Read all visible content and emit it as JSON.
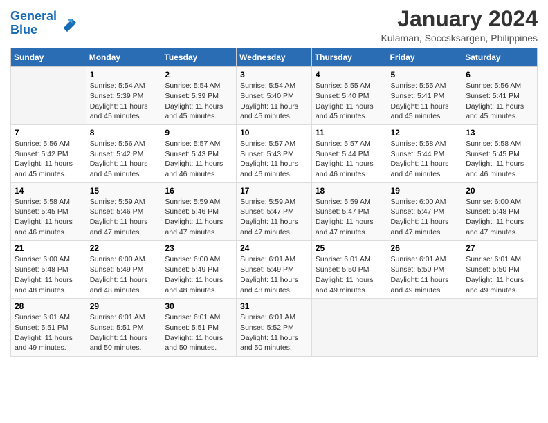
{
  "header": {
    "logo_line1": "General",
    "logo_line2": "Blue",
    "title": "January 2024",
    "subtitle": "Kulaman, Soccsksargen, Philippines"
  },
  "calendar": {
    "days_of_week": [
      "Sunday",
      "Monday",
      "Tuesday",
      "Wednesday",
      "Thursday",
      "Friday",
      "Saturday"
    ],
    "weeks": [
      [
        {
          "day": "",
          "info": ""
        },
        {
          "day": "1",
          "info": "Sunrise: 5:54 AM\nSunset: 5:39 PM\nDaylight: 11 hours\nand 45 minutes."
        },
        {
          "day": "2",
          "info": "Sunrise: 5:54 AM\nSunset: 5:39 PM\nDaylight: 11 hours\nand 45 minutes."
        },
        {
          "day": "3",
          "info": "Sunrise: 5:54 AM\nSunset: 5:40 PM\nDaylight: 11 hours\nand 45 minutes."
        },
        {
          "day": "4",
          "info": "Sunrise: 5:55 AM\nSunset: 5:40 PM\nDaylight: 11 hours\nand 45 minutes."
        },
        {
          "day": "5",
          "info": "Sunrise: 5:55 AM\nSunset: 5:41 PM\nDaylight: 11 hours\nand 45 minutes."
        },
        {
          "day": "6",
          "info": "Sunrise: 5:56 AM\nSunset: 5:41 PM\nDaylight: 11 hours\nand 45 minutes."
        }
      ],
      [
        {
          "day": "7",
          "info": "Sunrise: 5:56 AM\nSunset: 5:42 PM\nDaylight: 11 hours\nand 45 minutes."
        },
        {
          "day": "8",
          "info": "Sunrise: 5:56 AM\nSunset: 5:42 PM\nDaylight: 11 hours\nand 45 minutes."
        },
        {
          "day": "9",
          "info": "Sunrise: 5:57 AM\nSunset: 5:43 PM\nDaylight: 11 hours\nand 46 minutes."
        },
        {
          "day": "10",
          "info": "Sunrise: 5:57 AM\nSunset: 5:43 PM\nDaylight: 11 hours\nand 46 minutes."
        },
        {
          "day": "11",
          "info": "Sunrise: 5:57 AM\nSunset: 5:44 PM\nDaylight: 11 hours\nand 46 minutes."
        },
        {
          "day": "12",
          "info": "Sunrise: 5:58 AM\nSunset: 5:44 PM\nDaylight: 11 hours\nand 46 minutes."
        },
        {
          "day": "13",
          "info": "Sunrise: 5:58 AM\nSunset: 5:45 PM\nDaylight: 11 hours\nand 46 minutes."
        }
      ],
      [
        {
          "day": "14",
          "info": "Sunrise: 5:58 AM\nSunset: 5:45 PM\nDaylight: 11 hours\nand 46 minutes."
        },
        {
          "day": "15",
          "info": "Sunrise: 5:59 AM\nSunset: 5:46 PM\nDaylight: 11 hours\nand 47 minutes."
        },
        {
          "day": "16",
          "info": "Sunrise: 5:59 AM\nSunset: 5:46 PM\nDaylight: 11 hours\nand 47 minutes."
        },
        {
          "day": "17",
          "info": "Sunrise: 5:59 AM\nSunset: 5:47 PM\nDaylight: 11 hours\nand 47 minutes."
        },
        {
          "day": "18",
          "info": "Sunrise: 5:59 AM\nSunset: 5:47 PM\nDaylight: 11 hours\nand 47 minutes."
        },
        {
          "day": "19",
          "info": "Sunrise: 6:00 AM\nSunset: 5:47 PM\nDaylight: 11 hours\nand 47 minutes."
        },
        {
          "day": "20",
          "info": "Sunrise: 6:00 AM\nSunset: 5:48 PM\nDaylight: 11 hours\nand 47 minutes."
        }
      ],
      [
        {
          "day": "21",
          "info": "Sunrise: 6:00 AM\nSunset: 5:48 PM\nDaylight: 11 hours\nand 48 minutes."
        },
        {
          "day": "22",
          "info": "Sunrise: 6:00 AM\nSunset: 5:49 PM\nDaylight: 11 hours\nand 48 minutes."
        },
        {
          "day": "23",
          "info": "Sunrise: 6:00 AM\nSunset: 5:49 PM\nDaylight: 11 hours\nand 48 minutes."
        },
        {
          "day": "24",
          "info": "Sunrise: 6:01 AM\nSunset: 5:49 PM\nDaylight: 11 hours\nand 48 minutes."
        },
        {
          "day": "25",
          "info": "Sunrise: 6:01 AM\nSunset: 5:50 PM\nDaylight: 11 hours\nand 49 minutes."
        },
        {
          "day": "26",
          "info": "Sunrise: 6:01 AM\nSunset: 5:50 PM\nDaylight: 11 hours\nand 49 minutes."
        },
        {
          "day": "27",
          "info": "Sunrise: 6:01 AM\nSunset: 5:50 PM\nDaylight: 11 hours\nand 49 minutes."
        }
      ],
      [
        {
          "day": "28",
          "info": "Sunrise: 6:01 AM\nSunset: 5:51 PM\nDaylight: 11 hours\nand 49 minutes."
        },
        {
          "day": "29",
          "info": "Sunrise: 6:01 AM\nSunset: 5:51 PM\nDaylight: 11 hours\nand 50 minutes."
        },
        {
          "day": "30",
          "info": "Sunrise: 6:01 AM\nSunset: 5:51 PM\nDaylight: 11 hours\nand 50 minutes."
        },
        {
          "day": "31",
          "info": "Sunrise: 6:01 AM\nSunset: 5:52 PM\nDaylight: 11 hours\nand 50 minutes."
        },
        {
          "day": "",
          "info": ""
        },
        {
          "day": "",
          "info": ""
        },
        {
          "day": "",
          "info": ""
        }
      ]
    ]
  }
}
